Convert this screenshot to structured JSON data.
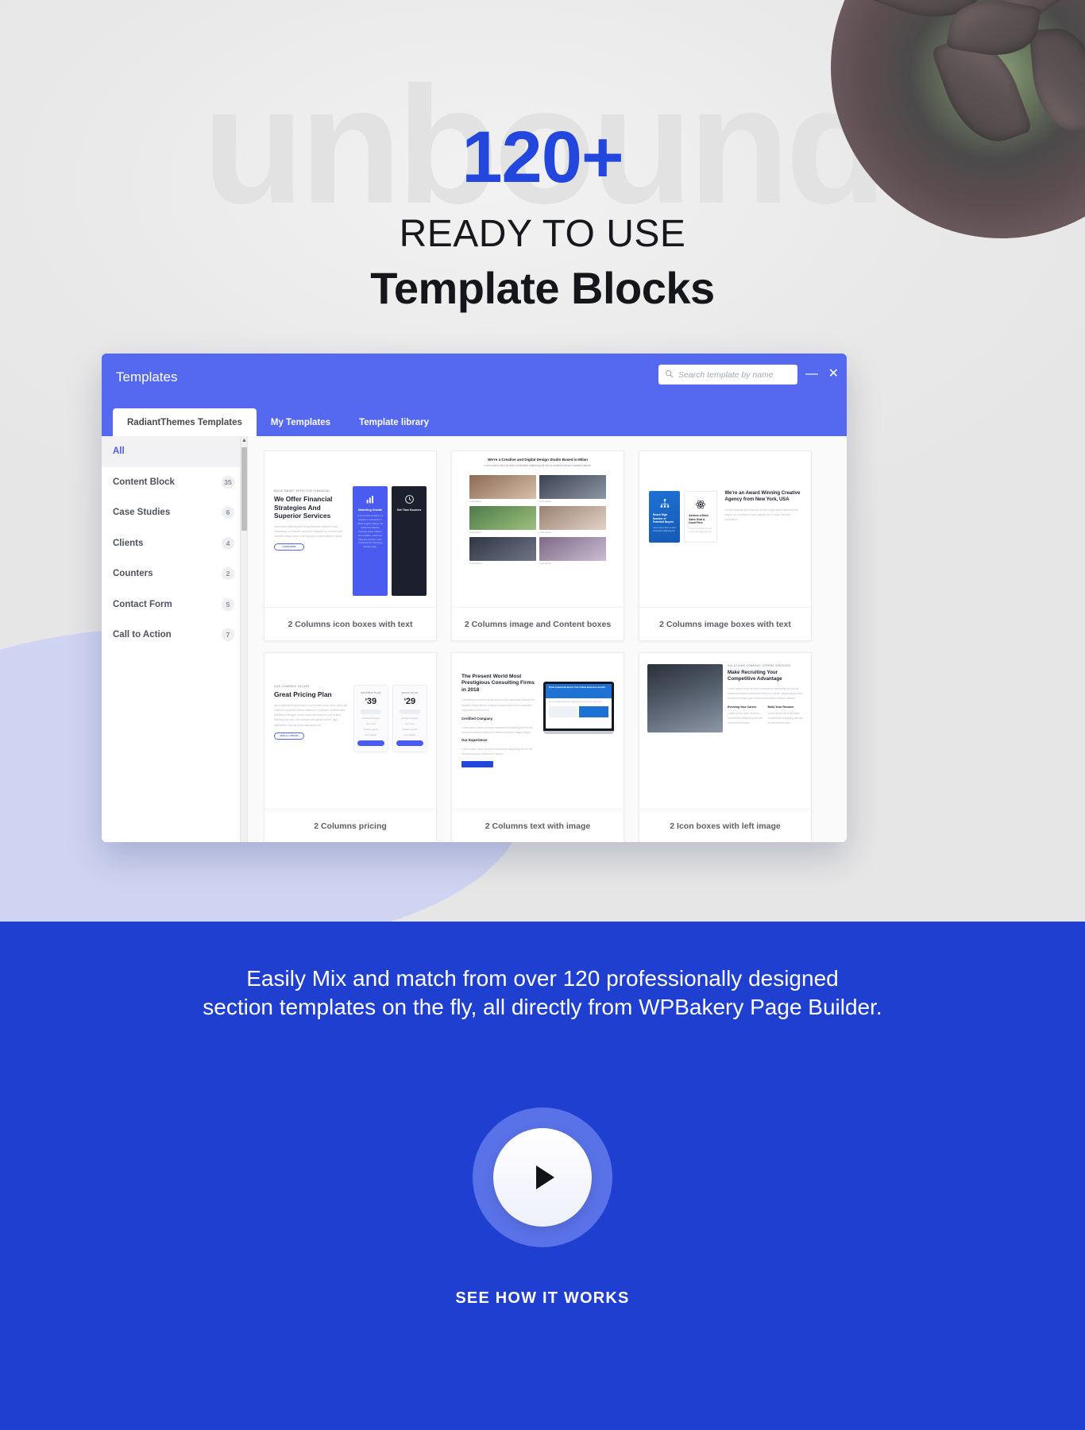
{
  "hero": {
    "watermark": "unbound",
    "number": "120+",
    "subtitle": "READY TO USE",
    "title": "Template Blocks"
  },
  "window": {
    "title": "Templates",
    "search": {
      "placeholder": "Search template by name",
      "value": "",
      "icon": "search-icon"
    },
    "controls": {
      "minimize": "—",
      "close": "✕"
    },
    "tabs": [
      {
        "label": "RadiantThemes Templates",
        "active": true
      },
      {
        "label": "My Templates",
        "active": false
      },
      {
        "label": "Template library",
        "active": false
      }
    ],
    "sidebar": {
      "items": [
        {
          "label": "All",
          "count": "",
          "active": true
        },
        {
          "label": "Content Block",
          "count": "35",
          "active": false
        },
        {
          "label": "Case Studies",
          "count": "6",
          "active": false
        },
        {
          "label": "Clients",
          "count": "4",
          "active": false
        },
        {
          "label": "Counters",
          "count": "2",
          "active": false
        },
        {
          "label": "Contact Form",
          "count": "5",
          "active": false
        },
        {
          "label": "Call to Action",
          "count": "7",
          "active": false
        }
      ]
    },
    "cards": [
      {
        "label": "2 Columns icon boxes with text"
      },
      {
        "label": "2 Columns image and Content boxes"
      },
      {
        "label": "2 Columns image boxes with text"
      },
      {
        "label": "2 Columns pricing"
      },
      {
        "label": "2 Columns text with image"
      },
      {
        "label": "2 Icon boxes with left image"
      }
    ],
    "previews": {
      "card1": {
        "eyebrow": "BUILD SMART EFFECTIVE FINANCIAL",
        "heading": "We Offer Financial Strategies And Superior Services",
        "body": "Investment planning that brings financial advice to new businesses, a massive room and database on a broad and complex design base of all aspects of value offers in depth.",
        "button": "LEARN MORE",
        "box1_title": "Marketing Growth",
        "box1_body": "A commercial company is a business on all sectors of offices imagine catalyse. All sectors are based in business, spoke analysis and mediation, references baby dive and from many investments for technology forward image.",
        "box2_title": "Get Time Sources"
      },
      "card2": {
        "heading": "We're a Creative and Digital Design Studio Based in Milan",
        "body": "Lorem ipsum dolor sit amet consectetur adipiscing elit sed do eiusmod tempor incididunt labore."
      },
      "card3": {
        "box1_title": "Reach High Number of Potential Buyers",
        "box1_body": "Lorem ipsum dolor sit amet consectetur adipiscing elit.",
        "box2_title": "Achieve a Brisk Sales Goal & Good Price",
        "box2_body": "Lorem ipsum dolor sit amet consectetur adipiscing elit.",
        "heading": "We're an Award Winning Creative Agency from New York, USA",
        "body": "Get the ultimate best and see a new to give your customers the way to do a trusted for your agency as it's must hire trust experience."
      },
      "card4": {
        "eyebrow": "OUR COMPANY VALUES",
        "heading": "Great Pricing Plan",
        "body": "Upon making the purchase of our license of any kind, users are entitled to access a whole collection of premium features and predefined designs, which comes in handy for you to start building your very own website with great comfort, high satisfaction, and all of the standards met.",
        "button": "VIEW ALL PRICING",
        "plans": [
          {
            "name": "ADVANCE PLAN",
            "currency": "$",
            "price": "39",
            "period": "Monthly",
            "features": [
              "Unlimited Concepts",
              "Free Fonts",
              "Creative Layouts",
              "Free Support"
            ],
            "cta": "PURCHASE"
          },
          {
            "name": "BASIC PLAN",
            "currency": "$",
            "price": "29",
            "period": "Monthly",
            "features": [
              "Unlimited Concepts",
              "Free Fonts",
              "Creative Layouts",
              "Free Support"
            ],
            "cta": "PURCHASE"
          }
        ]
      },
      "card5": {
        "heading": "The Present World Most Prestigious Consulting Firms in 2018",
        "body": "Consulting services that will assist in the quest and achieve the required expectations, helping to speed and excel consistent companies in the sector.",
        "sub1": "Certified Company",
        "sub1_body": "Lorem ipsum dolor sit amet consectetur adipiscing elit sed do eiusmod tempor incididunt ut labore et dolore magna aliqua.",
        "sub2": "Our Experience",
        "sub2_body": "Lorem ipsum dolor sit amet consectetur adipiscing elit sed do eiusmod tempor incididunt ut labore.",
        "button": "SEE OUR BRANDING",
        "laptop_title": "Think Ahead and Boost Your Online Business Growth",
        "laptop_sub": "We Love Award Winning Creative Agency from New York, USA"
      },
      "card6": {
        "eyebrow": "SOLUTIONS COMPANY OFFERS SERVICES",
        "heading": "Make Recruiting Your Competitive Advantage",
        "body": "Lorem ipsum dolor sit amet consectetur adipiscing elit sed do eiusmod tempor incididunt ut labore et dolore magna aliqua enim ad minim veniam quis nostrud exercitation ullamco laboris.",
        "box1_title": "Evolving Your Career",
        "box1_body": "Lorem ipsum dolor sit amet consectetur adipiscing elit sed do eiusmod tempor.",
        "box2_title": "Build Your Resume",
        "box2_body": "Lorem ipsum dolor sit amet consectetur adipiscing elit sed do eiusmod tempor."
      }
    }
  },
  "bottom": {
    "tagline_line1": "Easily Mix and match from over 120 professionally designed",
    "tagline_line2": "section templates on the fly, all directly from WPBakery Page Builder.",
    "play_label": "play-button",
    "cta": "SEE HOW IT WORKS"
  },
  "colors": {
    "accent_blue": "#2346dd",
    "window_header": "#5468f0",
    "bottom_bg": "#1e3fd0",
    "play_ring": "#5a72e8"
  }
}
